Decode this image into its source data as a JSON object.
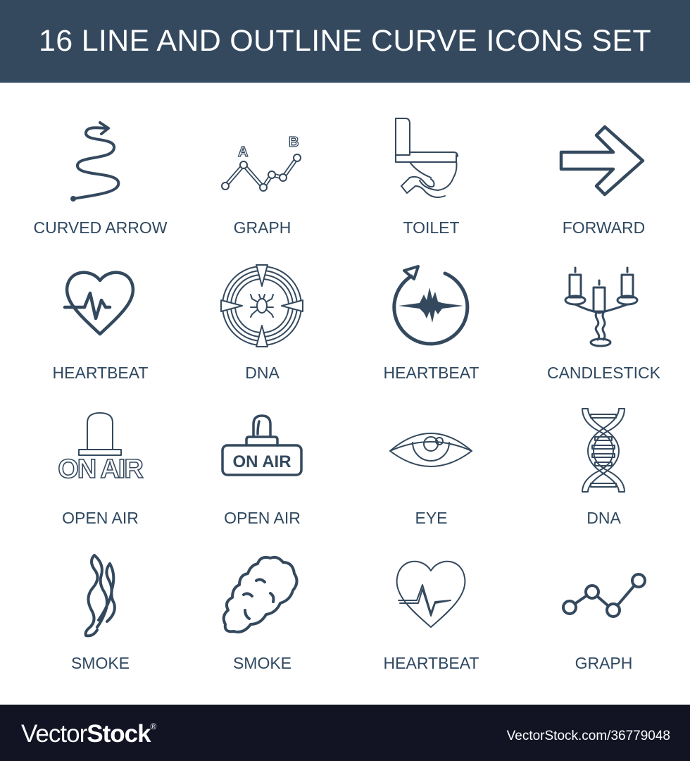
{
  "header": {
    "title": "16 LINE AND OUTLINE CURVE ICONS SET",
    "background_color": "#34495e"
  },
  "icon_color": "#34495e",
  "icons": [
    {
      "label": "CURVED ARROW",
      "icon": "curved-arrow-icon"
    },
    {
      "label": "GRAPH",
      "icon": "graph-ab-icon",
      "point_labels": [
        "A",
        "B"
      ]
    },
    {
      "label": "TOILET",
      "icon": "toilet-icon"
    },
    {
      "label": "FORWARD",
      "icon": "forward-arrow-icon"
    },
    {
      "label": "HEARTBEAT",
      "icon": "heartbeat-heart-icon"
    },
    {
      "label": "DNA",
      "icon": "bug-target-icon"
    },
    {
      "label": "HEARTBEAT",
      "icon": "heartbeat-cycle-icon"
    },
    {
      "label": "CANDLESTICK",
      "icon": "candlestick-icon"
    },
    {
      "label": "OPEN AIR",
      "icon": "on-air-lamp-icon",
      "sign_text": "ON AIR"
    },
    {
      "label": "OPEN AIR",
      "icon": "on-air-sign-icon",
      "sign_text": "ON AIR"
    },
    {
      "label": "EYE",
      "icon": "eye-icon"
    },
    {
      "label": "DNA",
      "icon": "dna-helix-icon"
    },
    {
      "label": "SMOKE",
      "icon": "smoke-wisp-icon"
    },
    {
      "label": "SMOKE",
      "icon": "smoke-cloud-icon"
    },
    {
      "label": "HEARTBEAT",
      "icon": "heartbeat-outline-icon"
    },
    {
      "label": "GRAPH",
      "icon": "graph-line-icon"
    }
  ],
  "footer": {
    "brand_light": "Vector",
    "brand_bold": "Stock",
    "brand_mark": "®",
    "stock_id": "VectorStock.com/36779048"
  }
}
